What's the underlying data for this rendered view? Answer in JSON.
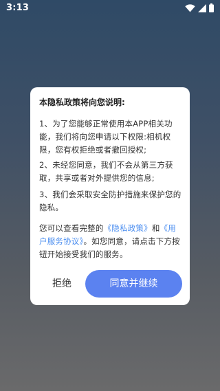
{
  "status_bar": {
    "time": "3:13",
    "icons": [
      "wifi-icon",
      "signal-icon",
      "battery-icon"
    ]
  },
  "dialog": {
    "title": "本隐私政策将向您说明:",
    "paragraph_1": "1、为了您能够正常使用本APP相关功能，我们将向您申请以下权限:相机权限，您有权拒绝或者撤回授权;",
    "paragraph_2": "2、未经您同意，我们不会从第三方获取，共享或者对外提供您的信息;",
    "paragraph_3": "3、我们会采取安全防护措施来保护您的隐私。",
    "notice": {
      "prefix": "您可以查看完整的",
      "privacy_link": "《隐私政策》",
      "and": "和",
      "agreement_link": "《用户服务协议》",
      "suffix": "。如您同意，请点击下方按钮开始接受我们的服务。"
    },
    "refuse_label": "拒绝",
    "agree_label": "同意并继续"
  },
  "colors": {
    "accent": "#5b82f0",
    "link": "#4d8ff0"
  }
}
